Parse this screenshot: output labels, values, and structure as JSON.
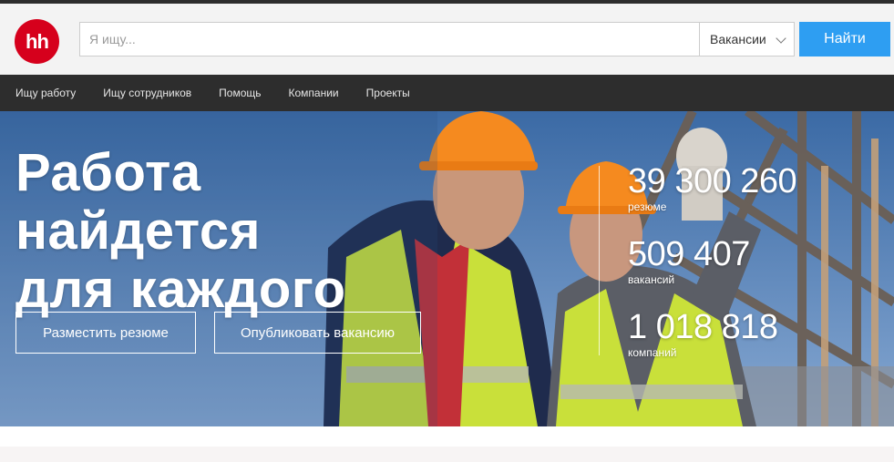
{
  "header": {
    "logo_text": "hh",
    "search_placeholder": "Я ищу...",
    "search_value": "",
    "select_value": "Вакансии",
    "find_label": "Найти",
    "brand_color": "#d6001c",
    "accent_color": "#2e9ef2"
  },
  "nav": {
    "items": [
      {
        "label": "Ищу работу"
      },
      {
        "label": "Ищу сотрудников"
      },
      {
        "label": "Помощь"
      },
      {
        "label": "Компании"
      },
      {
        "label": "Проекты"
      }
    ]
  },
  "hero": {
    "title_line1": "Работа найдется",
    "title_line2": "для каждого",
    "btn_resume": "Разместить резюме",
    "btn_vacancy": "Опубликовать вакансию",
    "stats": [
      {
        "value": "39 300 260",
        "label": "резюме"
      },
      {
        "value": "509 407",
        "label": "вакансий"
      },
      {
        "value": "1 018 818",
        "label": "компаний"
      }
    ]
  }
}
